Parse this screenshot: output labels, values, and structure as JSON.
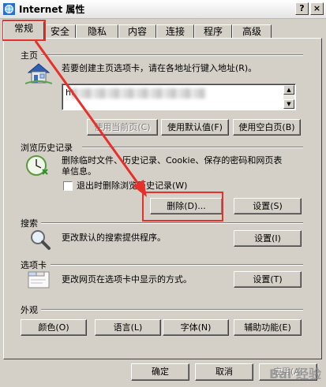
{
  "window": {
    "title": "Internet 属性",
    "help_btn": "?",
    "close_btn": "×"
  },
  "tabs": [
    "常规",
    "安全",
    "隐私",
    "内容",
    "连接",
    "程序",
    "高级"
  ],
  "home": {
    "label": "主页",
    "description": "若要创建主页选项卡，请在各地址行键入地址(R)。",
    "url_value": "ht",
    "btn_current": "使用当前页(C)",
    "btn_default": "使用默认值(F)",
    "btn_blank": "使用空白页(B)"
  },
  "history": {
    "label": "浏览历史记录",
    "description": "删除临时文件、历史记录、Cookie、保存的密码和网页表单信息。",
    "checkbox_label": "退出时删除浏览历史记录(W)",
    "btn_delete": "删除(D)...",
    "btn_settings": "设置(S)"
  },
  "search": {
    "label": "搜索",
    "description": "更改默认的搜索提供程序。",
    "btn_settings": "设置(I)"
  },
  "tabs_group": {
    "label": "选项卡",
    "description": "更改网页在选项卡中显示的方式。",
    "btn_settings": "设置(T)"
  },
  "appearance": {
    "label": "外观",
    "btn_colors": "颜色(O)",
    "btn_languages": "语言(L)",
    "btn_fonts": "字体(N)",
    "btn_accessibility": "辅助功能(E)"
  },
  "footer": {
    "btn_ok": "确定",
    "btn_cancel": "取消",
    "btn_apply": "应用(A)"
  },
  "watermark": "Bai 经验",
  "annotation_color": "#e8302a"
}
